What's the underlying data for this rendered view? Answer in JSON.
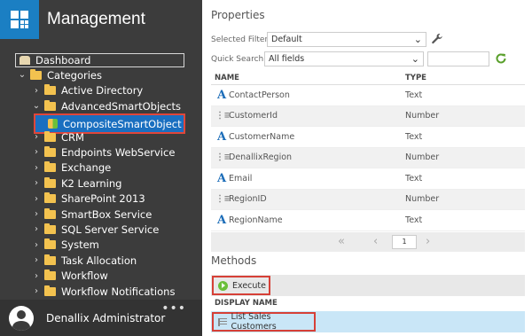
{
  "sidebar": {
    "title": "Management",
    "tree": [
      {
        "label": "Dashboard",
        "indent": 0,
        "chev": "",
        "icon": "dashboard-icon"
      },
      {
        "label": "Categories",
        "indent": 0,
        "chev": "⌄",
        "icon": "folder-icon"
      },
      {
        "label": "Active Directory",
        "indent": 1,
        "chev": "›",
        "icon": "folder-icon"
      },
      {
        "label": "AdvancedSmartObjects",
        "indent": 1,
        "chev": "⌄",
        "icon": "folder-icon"
      },
      {
        "label": "CompositeSmartObject",
        "indent": 2,
        "chev": "",
        "icon": "smartobject-icon"
      },
      {
        "label": "CRM",
        "indent": 1,
        "chev": "›",
        "icon": "folder-icon"
      },
      {
        "label": "Endpoints WebService",
        "indent": 1,
        "chev": "›",
        "icon": "folder-icon"
      },
      {
        "label": "Exchange",
        "indent": 1,
        "chev": "›",
        "icon": "folder-icon"
      },
      {
        "label": "K2 Learning",
        "indent": 1,
        "chev": "›",
        "icon": "folder-icon"
      },
      {
        "label": "SharePoint 2013",
        "indent": 1,
        "chev": "›",
        "icon": "folder-icon"
      },
      {
        "label": "SmartBox Service",
        "indent": 1,
        "chev": "›",
        "icon": "folder-icon"
      },
      {
        "label": "SQL Server Service",
        "indent": 1,
        "chev": "›",
        "icon": "folder-icon"
      },
      {
        "label": "System",
        "indent": 1,
        "chev": "›",
        "icon": "folder-icon"
      },
      {
        "label": "Task Allocation",
        "indent": 1,
        "chev": "›",
        "icon": "folder-icon"
      },
      {
        "label": "Workflow",
        "indent": 1,
        "chev": "›",
        "icon": "folder-icon"
      },
      {
        "label": "Workflow Notifications",
        "indent": 1,
        "chev": "›",
        "icon": "folder-icon"
      }
    ],
    "user_name": "Denallix Administrator",
    "more": "•••"
  },
  "properties": {
    "title": "Properties",
    "selected_filter_label": "Selected Filter:",
    "selected_filter_value": "Default",
    "quick_search_label": "Quick Search:",
    "quick_search_value": "All fields",
    "columns": {
      "name": "NAME",
      "type": "TYPE"
    },
    "rows": [
      {
        "name": "ContactPerson",
        "type": "Text",
        "icon": "text-type-icon"
      },
      {
        "name": "CustomerId",
        "type": "Number",
        "icon": "number-type-icon"
      },
      {
        "name": "CustomerName",
        "type": "Text",
        "icon": "text-type-icon"
      },
      {
        "name": "DenallixRegion",
        "type": "Number",
        "icon": "number-type-icon"
      },
      {
        "name": "Email",
        "type": "Text",
        "icon": "text-type-icon"
      },
      {
        "name": "RegionID",
        "type": "Number",
        "icon": "number-type-icon"
      },
      {
        "name": "RegionName",
        "type": "Text",
        "icon": "text-type-icon"
      }
    ],
    "page": "1"
  },
  "methods": {
    "title": "Methods",
    "execute_label": "Execute",
    "display_name_header": "DISPLAY NAME",
    "rows": [
      {
        "name": "List Sales Customers"
      }
    ]
  }
}
